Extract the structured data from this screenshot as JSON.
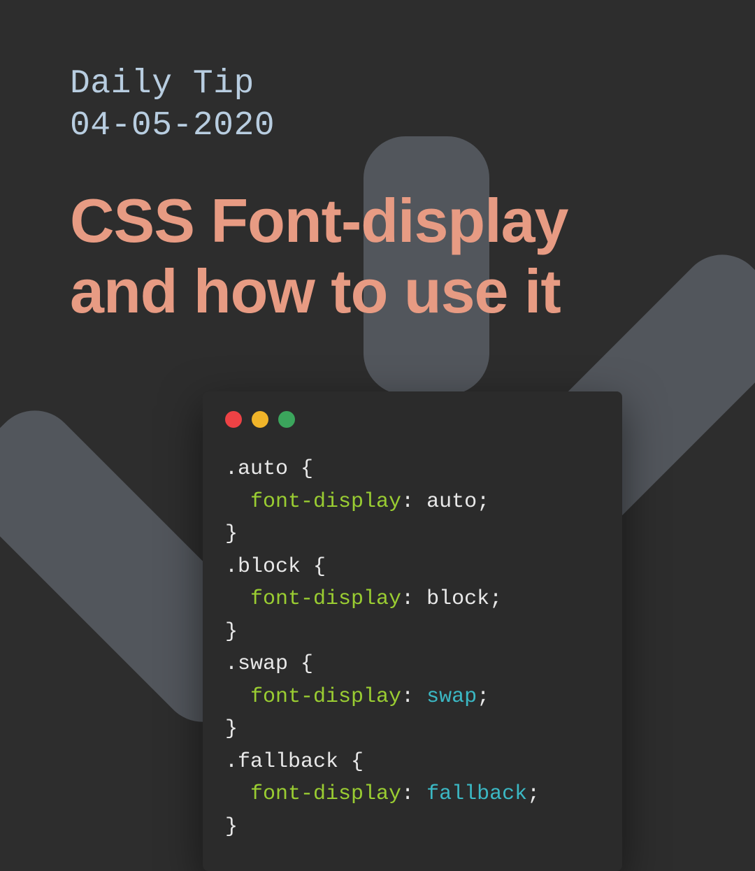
{
  "eyebrow": {
    "label": "Daily Tip",
    "date": "04-05-2020"
  },
  "title": "CSS Font-display and how to use it",
  "colors": {
    "bg": "#2d2d2d",
    "eyebrow": "#b8cde0",
    "title": "#e79b83",
    "codeBg": "#2b2b2b",
    "dotRed": "#ed4245",
    "dotYellow": "#f0b429",
    "dotGreen": "#3ba55c",
    "tokenDefault": "#e8e8e8",
    "tokenProp": "#9acd32",
    "tokenValAlt": "#3bb8c4"
  },
  "code": {
    "rules": [
      {
        "selector": ".auto",
        "prop": "font-display",
        "value": "auto",
        "valueColor": "default"
      },
      {
        "selector": ".block",
        "prop": "font-display",
        "value": "block",
        "valueColor": "default"
      },
      {
        "selector": ".swap",
        "prop": "font-display",
        "value": "swap",
        "valueColor": "alt"
      },
      {
        "selector": ".fallback",
        "prop": "font-display",
        "value": "fallback",
        "valueColor": "alt"
      }
    ]
  }
}
